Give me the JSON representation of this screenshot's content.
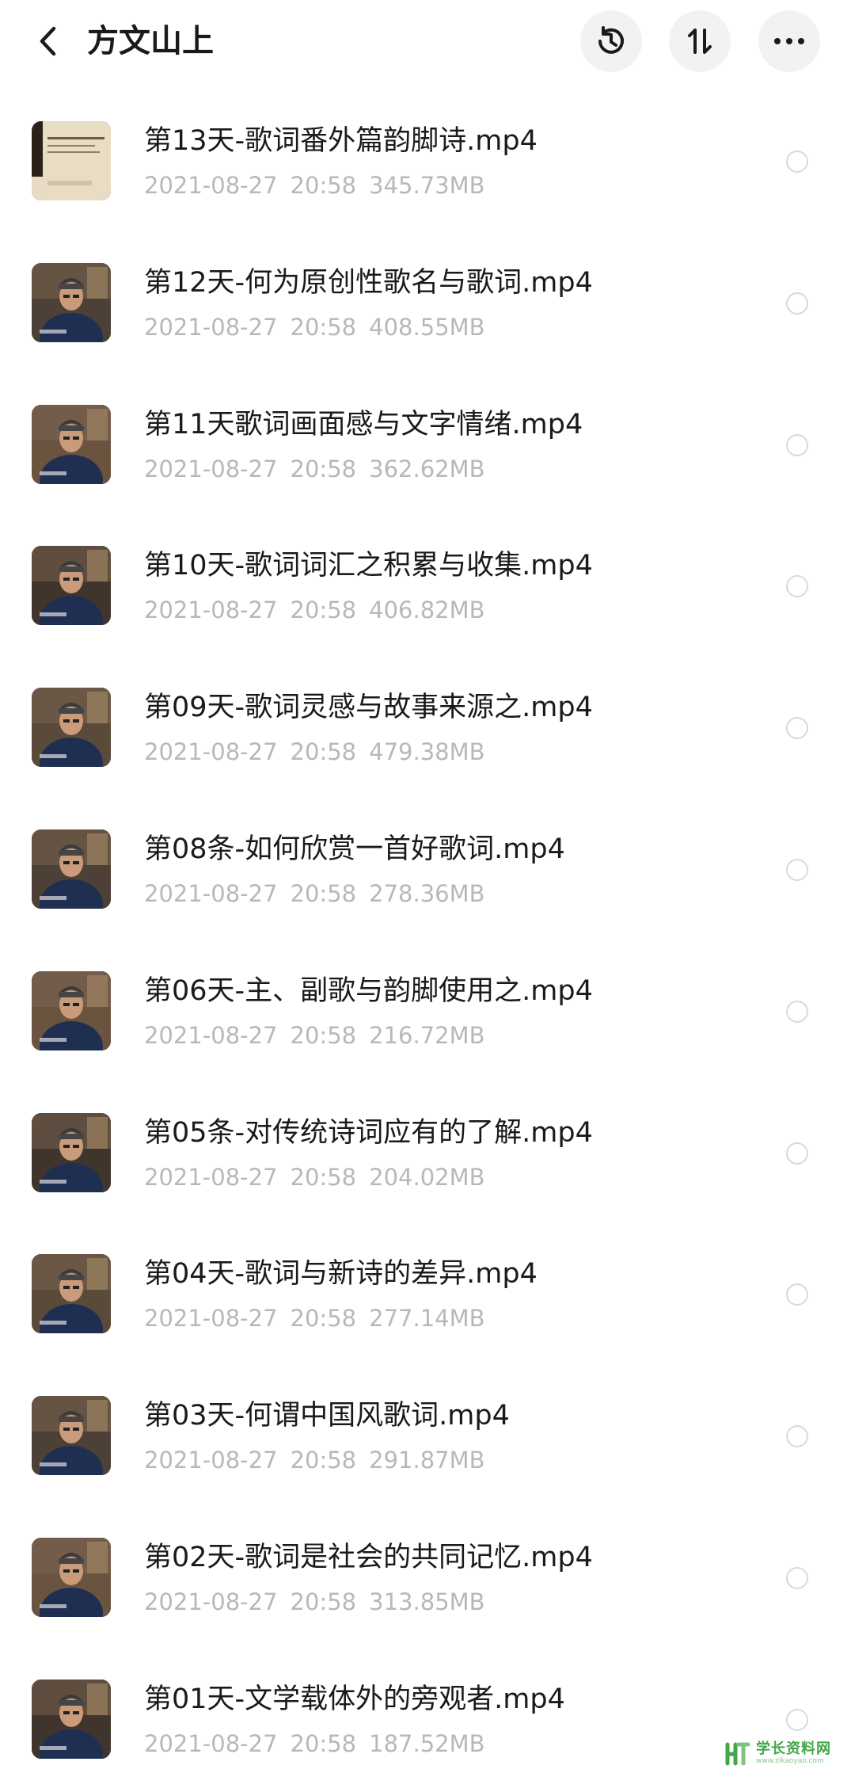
{
  "header": {
    "title": "方文山上",
    "back_icon": "chevron-left-icon",
    "history_icon": "history-clock-icon",
    "sort_icon": "sort-arrows-icon",
    "more_icon": "more-dots-icon"
  },
  "files": [
    {
      "name": "第13天-歌词番外篇韵脚诗.mp4",
      "date": "2021-08-27",
      "time": "20:58",
      "size": "345.73MB",
      "thumb": "document-page"
    },
    {
      "name": "第12天-何为原创性歌名与歌词.mp4",
      "date": "2021-08-27",
      "time": "20:58",
      "size": "408.55MB",
      "thumb": "speaker-video"
    },
    {
      "name": "第11天歌词画面感与文字情绪.mp4",
      "date": "2021-08-27",
      "time": "20:58",
      "size": "362.62MB",
      "thumb": "speaker-video"
    },
    {
      "name": "第10天-歌词词汇之积累与收集.mp4",
      "date": "2021-08-27",
      "time": "20:58",
      "size": "406.82MB",
      "thumb": "speaker-video"
    },
    {
      "name": "第09天-歌词灵感与故事来源之.mp4",
      "date": "2021-08-27",
      "time": "20:58",
      "size": "479.38MB",
      "thumb": "speaker-video"
    },
    {
      "name": "第08条-如何欣赏一首好歌词.mp4",
      "date": "2021-08-27",
      "time": "20:58",
      "size": "278.36MB",
      "thumb": "speaker-video"
    },
    {
      "name": "第06天-主、副歌与韵脚使用之.mp4",
      "date": "2021-08-27",
      "time": "20:58",
      "size": "216.72MB",
      "thumb": "speaker-video"
    },
    {
      "name": "第05条-对传统诗词应有的了解.mp4",
      "date": "2021-08-27",
      "time": "20:58",
      "size": "204.02MB",
      "thumb": "speaker-video"
    },
    {
      "name": "第04天-歌词与新诗的差异.mp4",
      "date": "2021-08-27",
      "time": "20:58",
      "size": "277.14MB",
      "thumb": "speaker-video"
    },
    {
      "name": "第03天-何谓中国风歌词.mp4",
      "date": "2021-08-27",
      "time": "20:58",
      "size": "291.87MB",
      "thumb": "speaker-video"
    },
    {
      "name": "第02天-歌词是社会的共同记忆.mp4",
      "date": "2021-08-27",
      "time": "20:58",
      "size": "313.85MB",
      "thumb": "speaker-video"
    },
    {
      "name": "第01天-文学载体外的旁观者.mp4",
      "date": "2021-08-27",
      "time": "20:58",
      "size": "187.52MB",
      "thumb": "speaker-video"
    }
  ],
  "watermark": {
    "main": "学长资料网",
    "sub": "www.zikaoyao.com",
    "icon": "watermark-logo-icon"
  },
  "colors": {
    "title_text": "#1a1a1a",
    "meta_text": "#b8b8b8",
    "header_button_bg": "#f2f2f2",
    "radio_border": "#d9d9d9",
    "watermark_green": "#43a64a"
  }
}
